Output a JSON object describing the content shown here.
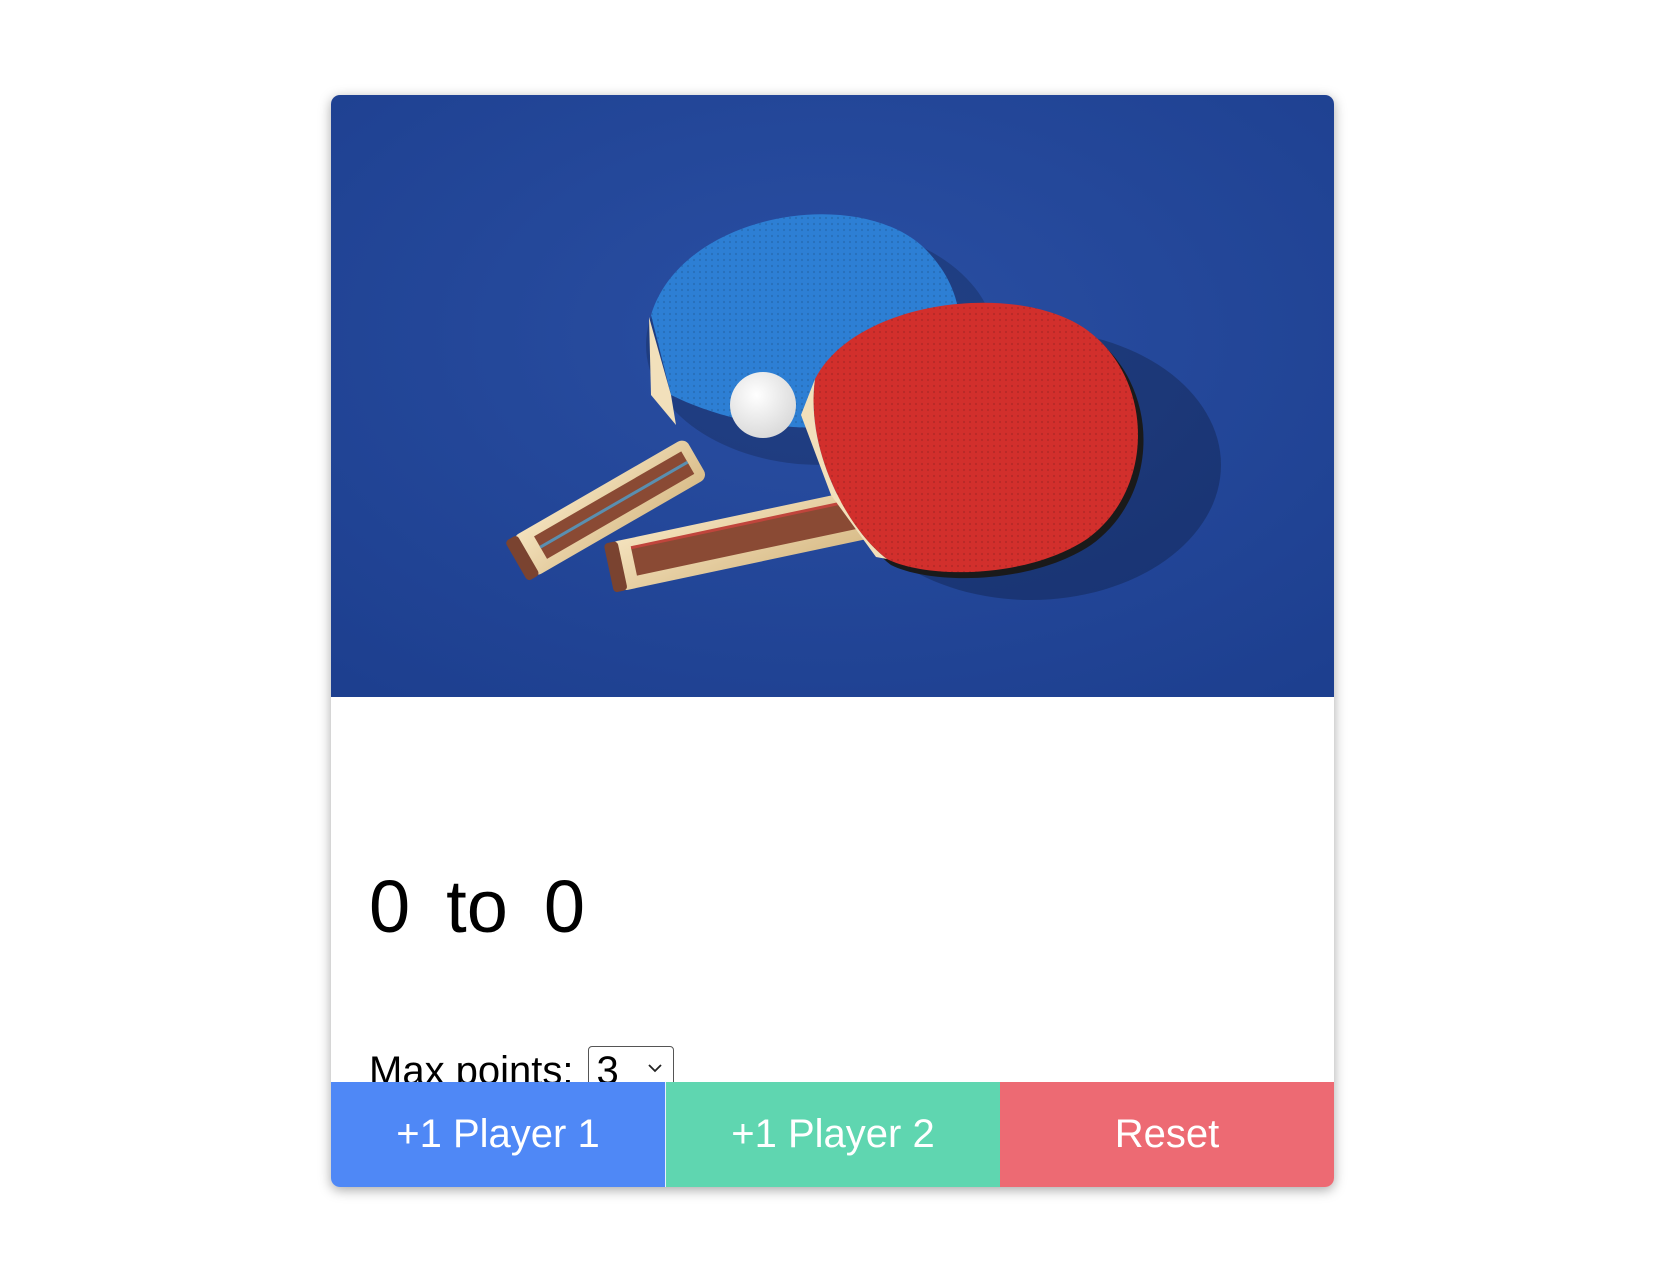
{
  "hero_image": {
    "icon": "ping-pong-paddles-image",
    "colors": {
      "table": "#22479a",
      "paddle_blue": "#2d7fd4",
      "paddle_red": "#d22f2c"
    }
  },
  "score": {
    "player1": "0",
    "separator": "to",
    "player2": "0"
  },
  "max_points": {
    "label": "Max points:",
    "selected": "3",
    "icon": "chevron-down-icon"
  },
  "buttons": {
    "player1": "+1 Player 1",
    "player2": "+1 Player 2",
    "reset": "Reset"
  },
  "colors": {
    "player1_button": "#4f88f6",
    "player2_button": "#5fd6b0",
    "reset_button": "#ed6a73"
  }
}
